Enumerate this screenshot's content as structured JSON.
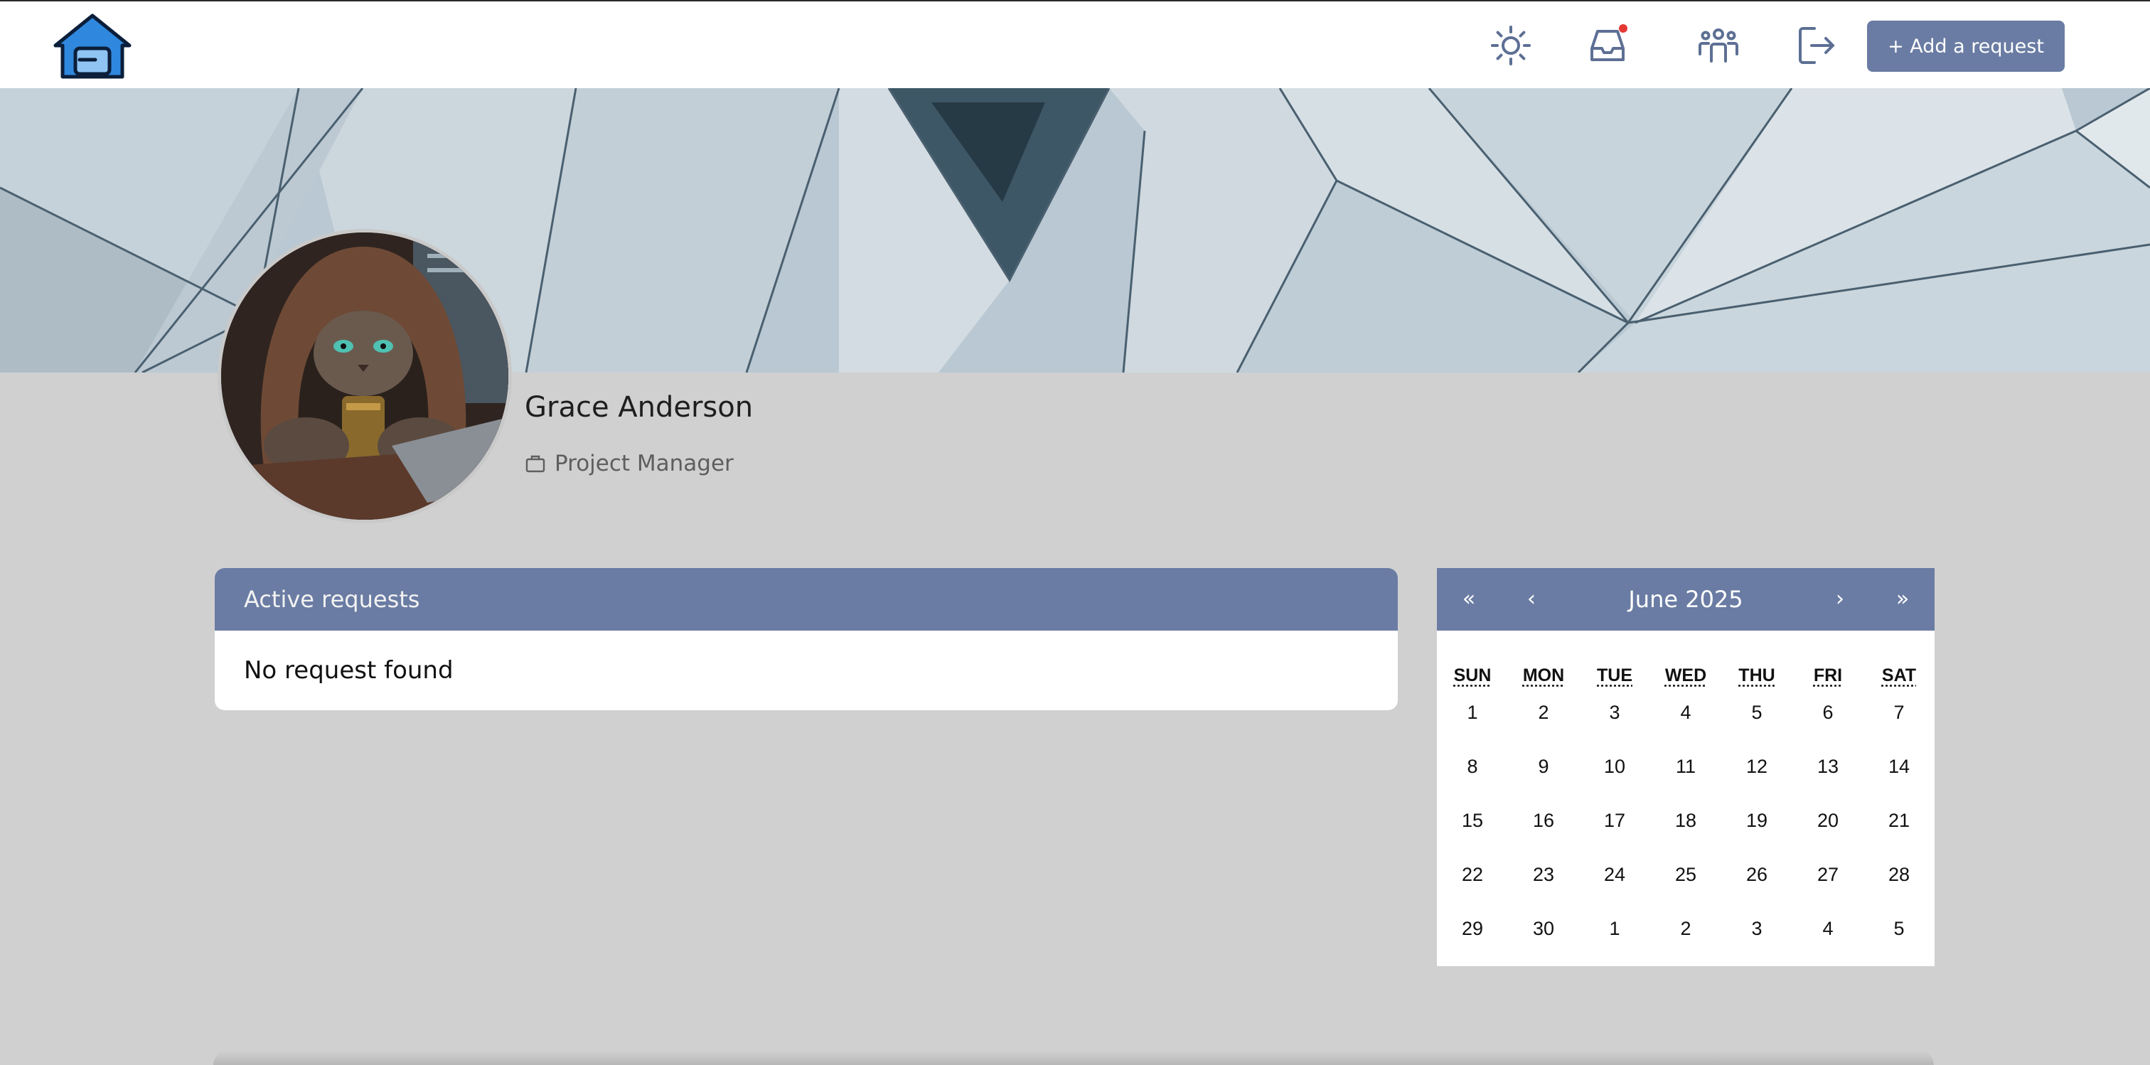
{
  "colors": {
    "accent": "#6a7ca3",
    "icon": "#5d6f94",
    "notification": "#e53935",
    "page_bg": "#d0d0d0",
    "logo_blue": "#2f88de"
  },
  "navbar": {
    "logo_icon": "home-logo-icon",
    "icons": [
      "sun-icon",
      "inbox-icon",
      "team-icon",
      "logout-icon"
    ],
    "add_request_label": "+ Add a request"
  },
  "profile": {
    "name": "Grace Anderson",
    "role": "Project Manager",
    "role_icon": "briefcase-icon",
    "avatar": "hooded-cat-avatar"
  },
  "requests": {
    "title": "Active requests",
    "empty_message": "No request found"
  },
  "calendar": {
    "prev_year": "«",
    "prev_month": "‹",
    "title": "June 2025",
    "next_month": "›",
    "next_year": "»",
    "weekdays": [
      "SUN",
      "MON",
      "TUE",
      "WED",
      "THU",
      "FRI",
      "SAT"
    ],
    "weeks": [
      [
        "1",
        "2",
        "3",
        "4",
        "5",
        "6",
        "7"
      ],
      [
        "8",
        "9",
        "10",
        "11",
        "12",
        "13",
        "14"
      ],
      [
        "15",
        "16",
        "17",
        "18",
        "19",
        "20",
        "21"
      ],
      [
        "22",
        "23",
        "24",
        "25",
        "26",
        "27",
        "28"
      ],
      [
        "29",
        "30",
        "1",
        "2",
        "3",
        "4",
        "5"
      ]
    ]
  }
}
